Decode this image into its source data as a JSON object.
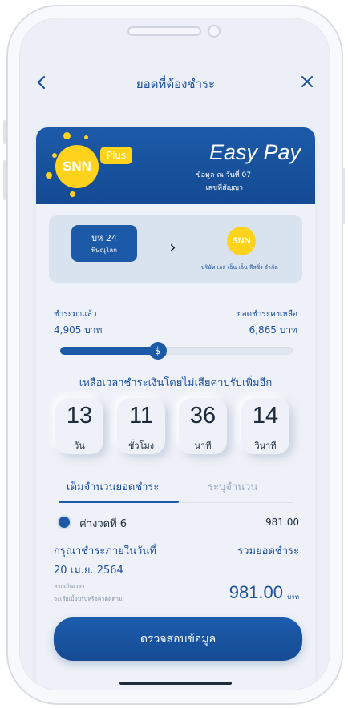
{
  "header": {
    "title": "ยอดที่ต้องชำระ",
    "back_icon": "chevron-left-icon",
    "close_icon": "close-icon"
  },
  "banner": {
    "logo_text": "SNN",
    "plus_label": "Plus",
    "title": "Easy Pay",
    "info_line1": "ข้อมูล ณ วันที่ 07",
    "info_line2": "เลขที่สัญญา"
  },
  "transfer": {
    "plate_line1": "บห 24",
    "plate_line2": "พิษณุโลก",
    "arrow": "›",
    "company_logo": "SNN",
    "company_name": "บริษัท เอส เอ็น เอ็น ลีสซิ่ง จำกัด"
  },
  "payment": {
    "paid_label": "ชำระมาแล้ว",
    "paid_value": "4,905 บาท",
    "remaining_label": "ยอดชำระคงเหลือ",
    "remaining_value": "6,865 บาท",
    "progress_fraction": 0.42,
    "thumb_symbol": "$"
  },
  "countdown": {
    "title": "เหลือเวลาชำระเงินโดยไม่เสียค่าปรับเพิ่มอีก",
    "items": [
      {
        "value": "13",
        "unit": "วัน"
      },
      {
        "value": "11",
        "unit": "ชั่วโมง"
      },
      {
        "value": "36",
        "unit": "นาที"
      },
      {
        "value": "14",
        "unit": "วินาที"
      }
    ]
  },
  "tabs": {
    "full_amount": "เต็มจำนวนยอดชำระ",
    "specify_amount": "ระบุจำนวน"
  },
  "installment": {
    "label": "ค่างวดที่ 6",
    "amount": "981.00"
  },
  "summary": {
    "pay_by_label": "กรุณาชำระภายในวันที่",
    "pay_by_date": "20 เม.ย. 2564",
    "total_label": "รวมยอดชำระ",
    "late_note_line1": "หากเกินเวลา",
    "late_note_line2": "จะเสียเบี้ยปรับหรือค่าติดตาม",
    "total_amount": "981.00",
    "total_unit": "บาท"
  },
  "cta_label": "ตรวจสอบข้อมูล",
  "colors": {
    "primary": "#1c5aa8",
    "brand_yellow": "#ffd21c",
    "text_dark": "#1e2b3c"
  }
}
